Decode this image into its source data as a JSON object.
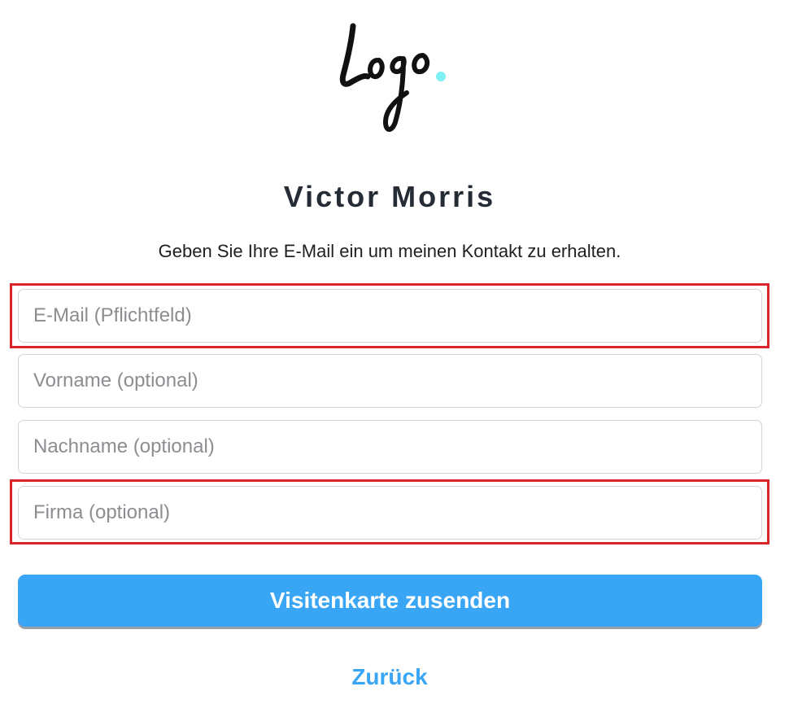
{
  "logo": {
    "text": "Logo",
    "dot_color": "#7ef1f5"
  },
  "profile": {
    "name": "Victor Morris",
    "instruction": "Geben Sie Ihre E-Mail ein um meinen Kontakt zu erhalten."
  },
  "form": {
    "email_placeholder": "E-Mail (Pflichtfeld)",
    "firstname_placeholder": "Vorname (optional)",
    "lastname_placeholder": "Nachname (optional)",
    "company_placeholder": "Firma (optional)",
    "submit_label": "Visitenkarte zusenden",
    "back_label": "Zurück"
  },
  "colors": {
    "accent": "#39a5f5",
    "highlight": "#d9262a",
    "title": "#262c35"
  }
}
